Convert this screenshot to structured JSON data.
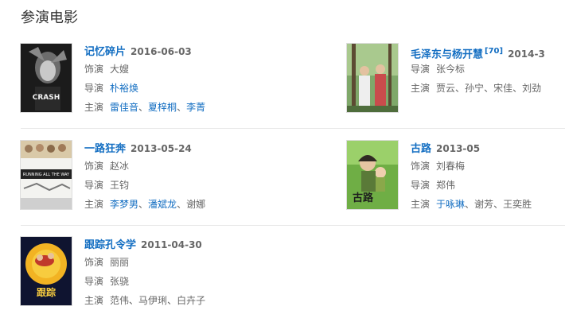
{
  "section": {
    "title": "参演电影"
  },
  "films": [
    {
      "title": "记忆碎片",
      "date": "2016-06-03",
      "footnote": "",
      "role_label": "饰演",
      "role": "大嫂",
      "director_label": "导演",
      "director": "朴裕焕",
      "director_link": true,
      "stars_label": "主演",
      "stars": [
        "雷佳音",
        "夏梓桐",
        "李菁"
      ],
      "stars_links": [
        true,
        true,
        true
      ]
    },
    {
      "title": "毛泽东与杨开慧",
      "date": "2014-3",
      "footnote": "[70]",
      "role_label": "饰演",
      "role": "",
      "director_label": "导演",
      "director": "张今标",
      "director_link": false,
      "stars_label": "主演",
      "stars": [
        "贾云",
        "孙宁",
        "宋佳",
        "刘劲"
      ],
      "stars_links": [
        false,
        false,
        false,
        false
      ]
    },
    {
      "title": "一路狂奔",
      "date": "2013-05-24",
      "footnote": "",
      "role_label": "饰演",
      "role": "赵冰",
      "director_label": "导演",
      "director": "王钧",
      "director_link": false,
      "stars_label": "主演",
      "stars": [
        "李梦男",
        "潘斌龙",
        "谢娜"
      ],
      "stars_links": [
        true,
        true,
        false
      ]
    },
    {
      "title": "古路",
      "date": "2013-05",
      "footnote": "",
      "role_label": "饰演",
      "role": "刘春梅",
      "director_label": "导演",
      "director": "郑伟",
      "director_link": false,
      "stars_label": "主演",
      "stars": [
        "于咏琳",
        "谢芳",
        "王奕胜"
      ],
      "stars_links": [
        true,
        false,
        false
      ]
    },
    {
      "title": "跟踪孔令学",
      "date": "2011-04-30",
      "footnote": "",
      "role_label": "饰演",
      "role": "丽丽",
      "director_label": "导演",
      "director": "张骁",
      "director_link": false,
      "stars_label": "主演",
      "stars": [
        "范伟",
        "马伊琍",
        "白卉子"
      ],
      "stars_links": [
        false,
        false,
        false
      ]
    }
  ],
  "poster_texts": {
    "p1": "CRASH",
    "p3": "RUNNING ALL THE WAY",
    "p4": "古路",
    "p5": "跟踪"
  }
}
